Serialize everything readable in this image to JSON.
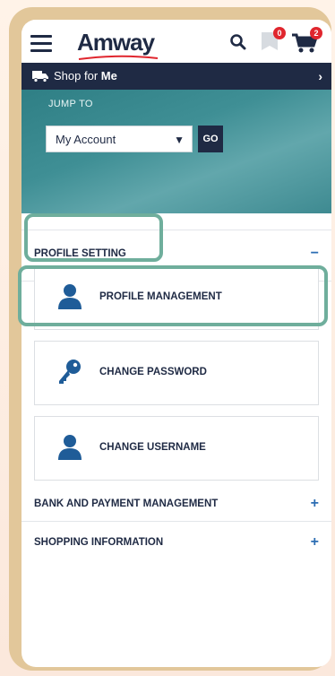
{
  "header": {
    "logo_text": "Amway",
    "flag_badge": "0",
    "cart_badge": "2"
  },
  "shopbar": {
    "prefix": "Shop for",
    "emphasis": "Me"
  },
  "jump": {
    "label": "JUMP TO",
    "selected": "My Account",
    "go_label": "GO"
  },
  "sections": {
    "profile_setting": {
      "title": "PROFILE SETTING",
      "toggle": "−"
    },
    "bank": {
      "title": "BANK AND PAYMENT MANAGEMENT",
      "toggle": "+"
    },
    "shopping": {
      "title": "SHOPPING INFORMATION",
      "toggle": "+"
    }
  },
  "cards": {
    "profile_management": "PROFILE MANAGEMENT",
    "change_password": "CHANGE PASSWORD",
    "change_username": "CHANGE USERNAME"
  },
  "colors": {
    "navy": "#1f2a44",
    "teal_band": "#3f8f95",
    "highlight": "#6fae9c",
    "accent_blue": "#2b6db3",
    "badge_red": "#e0262e"
  },
  "icons": [
    "hamburger-icon",
    "search-icon",
    "flag-icon",
    "cart-icon",
    "truck-icon",
    "chevron-right-icon",
    "chevron-down-icon",
    "user-icon",
    "key-icon"
  ]
}
